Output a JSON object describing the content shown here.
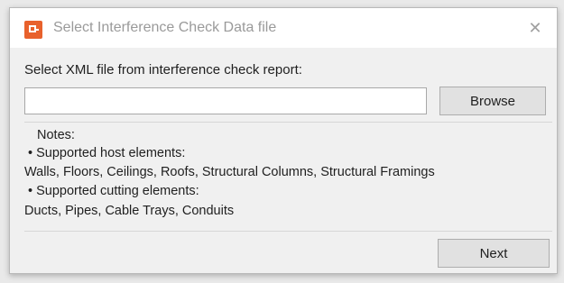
{
  "window": {
    "title": "Select Interference Check Data file",
    "close_glyph": "✕",
    "app_icon": "app-logo-icon",
    "accent": "#e8612c"
  },
  "main": {
    "prompt": "Select XML file from interference check report:",
    "file_input": {
      "value": "",
      "placeholder": ""
    },
    "browse_label": "Browse"
  },
  "notes": {
    "title": "Notes:",
    "lines": [
      "• Supported host elements:",
      "Walls, Floors, Ceilings, Roofs, Structural Columns, Structural Framings",
      "• Supported cutting elements:",
      "Ducts, Pipes, Cable Trays, Conduits"
    ]
  },
  "footer": {
    "next_label": "Next"
  }
}
